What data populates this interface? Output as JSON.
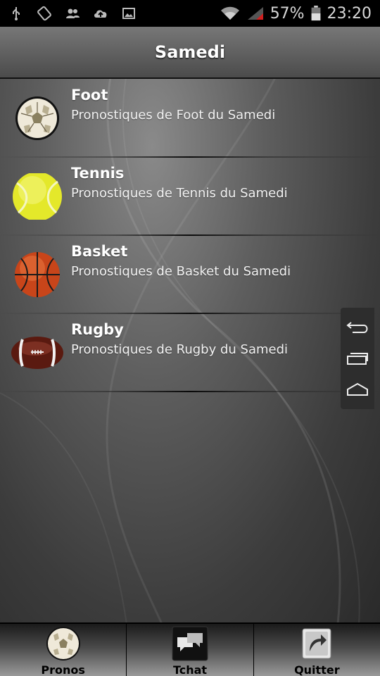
{
  "status_bar": {
    "battery_percent": "57%",
    "clock": "23:20",
    "icons": [
      "usb-icon",
      "screen-rotation-icon",
      "people-icon",
      "cloud-upload-icon",
      "image-icon",
      "wifi-icon",
      "signal-icon",
      "battery-icon"
    ]
  },
  "header": {
    "title": "Samedi"
  },
  "list": [
    {
      "title": "Foot",
      "subtitle": "Pronostiques de Foot du Samedi",
      "icon": "soccer-ball-icon"
    },
    {
      "title": "Tennis",
      "subtitle": "Pronostiques de Tennis du Samedi",
      "icon": "tennis-ball-icon"
    },
    {
      "title": "Basket",
      "subtitle": "Pronostiques de Basket du Samedi",
      "icon": "basketball-icon"
    },
    {
      "title": "Rugby",
      "subtitle": "Pronostiques de Rugby du Samedi",
      "icon": "rugby-ball-icon"
    }
  ],
  "floating_nav": {
    "icons": [
      "back-icon",
      "recent-apps-icon",
      "home-icon"
    ]
  },
  "tabbar": {
    "tabs": [
      {
        "label": "Pronos",
        "icon": "soccer-ball-icon"
      },
      {
        "label": "Tchat",
        "icon": "chat-bubbles-icon"
      },
      {
        "label": "Quitter",
        "icon": "exit-arrow-icon"
      }
    ]
  },
  "colors": {
    "status_bar_bg": "#000000",
    "header_bg": "#5f5f5f",
    "text_primary": "#ffffff",
    "tennis_ball": "#e8ec2a",
    "basketball": "#d9531e",
    "rugby_ball": "#6b1f14"
  }
}
